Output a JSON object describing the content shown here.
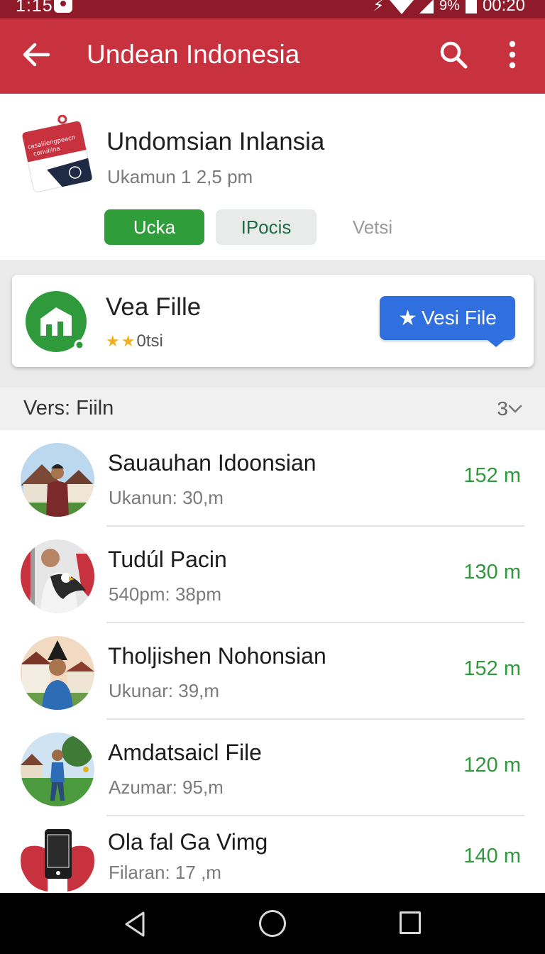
{
  "status_bar": {
    "time": "1:15",
    "battery_percent": "9%",
    "clock_right": "00:20",
    "bluetooth_glyph": "⚡"
  },
  "app_bar": {
    "title": "Undean Indonesia",
    "icons": [
      "arrow-back-icon",
      "search-icon",
      "more-vert-icon"
    ],
    "color": "#c8313e"
  },
  "header": {
    "app_name": "Undomsian Inlansia",
    "meta": "Ukamun 1 2,5 pm",
    "logo_text_line1": "casaiilengpeacn",
    "logo_text_line2": "conuliina",
    "chips": [
      {
        "label": "Ucka",
        "state": "active"
      },
      {
        "label": "IPocis",
        "state": "secondary"
      },
      {
        "label": "Vetsi",
        "state": "text"
      }
    ]
  },
  "featured": {
    "title": "Vea Fille",
    "rating_text": "0tsi",
    "stars": 2,
    "button_label": "Vesi File",
    "button_color": "#2f6fe0"
  },
  "section": {
    "title": "Vers: Fiiln",
    "count": "3"
  },
  "list": [
    {
      "title": "Sauauhan Idoonsian",
      "subtitle": "Ukanun: 30,m",
      "value": "152 m",
      "avatar": "man-in-front-of-house"
    },
    {
      "title": "Tudúl Pacin",
      "subtitle": "540pm: 38pm",
      "value": "130 m",
      "avatar": "man-with-eagle"
    },
    {
      "title": "Tholjishen Nohonsian",
      "subtitle": "Ukunar: 39,m",
      "value": "152 m",
      "avatar": "boy-with-hat"
    },
    {
      "title": "Amdatsaicl File",
      "subtitle": "Azumar: 95,m",
      "value": "120 m",
      "avatar": "man-on-field"
    },
    {
      "title": "Ola fal Ga Vimg",
      "subtitle": "Filaran: 17 ,m",
      "value": "140 m",
      "avatar": "phone-icon"
    }
  ],
  "nav_bar": {
    "icons": [
      "nav-back-icon",
      "nav-home-icon",
      "nav-recent-icon"
    ]
  }
}
